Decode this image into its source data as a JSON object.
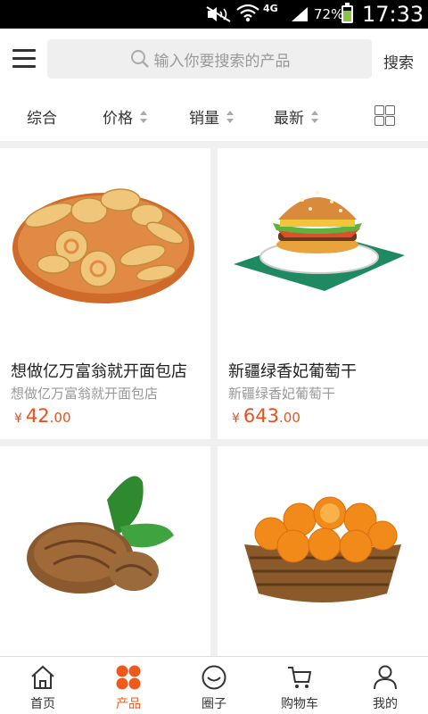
{
  "status_bar": {
    "battery_percent": "72%",
    "time": "17:33",
    "network": "4G",
    "icons": [
      "mute-icon",
      "wifi-icon",
      "signal-icon",
      "battery-icon"
    ]
  },
  "header": {
    "search_placeholder": "输入你要搜索的产品",
    "search_button": "搜索",
    "icons": [
      "menu-icon",
      "search-icon"
    ]
  },
  "sort_bar": {
    "items": [
      {
        "label": "综合"
      },
      {
        "label": "价格"
      },
      {
        "label": "销量"
      },
      {
        "label": "最新"
      }
    ],
    "view_toggle_icon": "grid-view-icon"
  },
  "products": [
    {
      "name": "想做亿万富翁就开面包店",
      "subtitle": "想做亿万富翁就开面包店",
      "currency": "¥",
      "price_int": "42",
      "price_dec": ".00",
      "image": "cookies-plate"
    },
    {
      "name": "新疆绿香妃葡萄干",
      "subtitle": "新疆绿香妃葡萄干",
      "currency": "¥",
      "price_int": "643",
      "price_dec": ".00",
      "image": "hamburger-plate"
    },
    {
      "name": "",
      "subtitle": "",
      "currency": "",
      "price_int": "",
      "price_dec": "",
      "image": "walnut"
    },
    {
      "name": "",
      "subtitle": "",
      "currency": "",
      "price_int": "",
      "price_dec": "",
      "image": "orange-basket"
    }
  ],
  "tab_bar": {
    "active_color": "#ef5a1c",
    "items": [
      {
        "label": "首页",
        "icon": "home-icon"
      },
      {
        "label": "产品",
        "icon": "products-icon",
        "active": true
      },
      {
        "label": "圈子",
        "icon": "circle-smile-icon"
      },
      {
        "label": "购物车",
        "icon": "cart-icon"
      },
      {
        "label": "我的",
        "icon": "user-icon"
      }
    ]
  }
}
